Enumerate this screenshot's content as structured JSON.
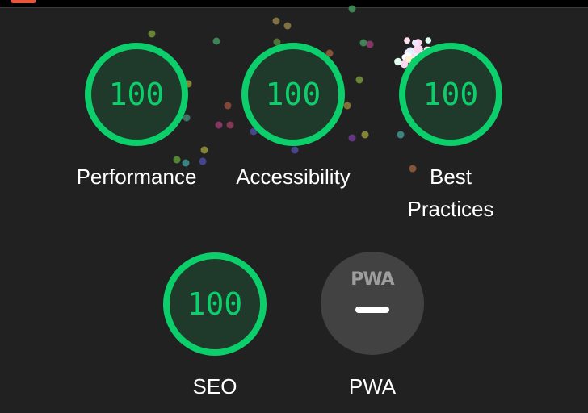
{
  "colors": {
    "pass": "#0cce6b",
    "pass_fill": "#1f3a2b",
    "background": "#212121",
    "pwa_badge": "#424242"
  },
  "categories": [
    {
      "id": "performance",
      "score": "100",
      "label": "Performance",
      "score_fraction": 1.0
    },
    {
      "id": "accessibility",
      "score": "100",
      "label": "Accessibility",
      "score_fraction": 1.0
    },
    {
      "id": "best-practices",
      "score": "100",
      "label_line1": "Best",
      "label_line2": "Practices",
      "score_fraction": 1.0
    },
    {
      "id": "seo",
      "score": "100",
      "label": "SEO",
      "score_fraction": 1.0
    }
  ],
  "pwa": {
    "badge_text": "PWA",
    "label": "PWA",
    "icon": "pwa-badge-icon"
  }
}
